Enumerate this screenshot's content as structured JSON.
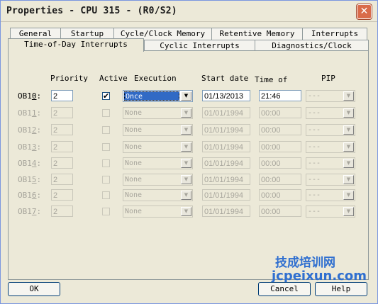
{
  "window": {
    "title": "Properties - CPU 315 - (R0/S2)",
    "close_glyph": "✕"
  },
  "tabs_row1": [
    "General",
    "Startup",
    "Cycle/Clock Memory",
    "Retentive Memory",
    "Interrupts"
  ],
  "tabs_row2": [
    "Time-of-Day Interrupts",
    "Cyclic Interrupts",
    "Diagnostics/Clock"
  ],
  "headers": {
    "priority": "Priority",
    "active": "Active",
    "execution": "Execution",
    "start_date": "Start date",
    "time_of": "Time of",
    "pip": "PIP"
  },
  "rows": [
    {
      "ob": "OB10",
      "ob_ul": "0",
      "priority": "2",
      "active": true,
      "execution": "Once",
      "start_date": "01/13/2013",
      "time": "21:46",
      "pip": "---",
      "enabled": true
    },
    {
      "ob": "OB11",
      "ob_ul": "1",
      "priority": "2",
      "active": false,
      "execution": "None",
      "start_date": "01/01/1994",
      "time": "00:00",
      "pip": "---",
      "enabled": false
    },
    {
      "ob": "OB12",
      "ob_ul": "2",
      "priority": "2",
      "active": false,
      "execution": "None",
      "start_date": "01/01/1994",
      "time": "00:00",
      "pip": "---",
      "enabled": false
    },
    {
      "ob": "OB13",
      "ob_ul": "3",
      "priority": "2",
      "active": false,
      "execution": "None",
      "start_date": "01/01/1994",
      "time": "00:00",
      "pip": "---",
      "enabled": false
    },
    {
      "ob": "OB14",
      "ob_ul": "4",
      "priority": "2",
      "active": false,
      "execution": "None",
      "start_date": "01/01/1994",
      "time": "00:00",
      "pip": "---",
      "enabled": false
    },
    {
      "ob": "OB15",
      "ob_ul": "5",
      "priority": "2",
      "active": false,
      "execution": "None",
      "start_date": "01/01/1994",
      "time": "00:00",
      "pip": "---",
      "enabled": false
    },
    {
      "ob": "OB16",
      "ob_ul": "6",
      "priority": "2",
      "active": false,
      "execution": "None",
      "start_date": "01/01/1994",
      "time": "00:00",
      "pip": "---",
      "enabled": false
    },
    {
      "ob": "OB17",
      "ob_ul": "7",
      "priority": "2",
      "active": false,
      "execution": "None",
      "start_date": "01/01/1994",
      "time": "00:00",
      "pip": "---",
      "enabled": false
    }
  ],
  "buttons": {
    "ok": "OK",
    "cancel": "Cancel",
    "help": "Help"
  },
  "watermark": {
    "line1": "技成培训网",
    "line2": "jcpeixun.com"
  },
  "colors": {
    "selection": "#316ac5",
    "close": "#d96b4a",
    "watermark": "#2f6fd0"
  },
  "icons": {
    "check": "✔",
    "dropdown": "▼"
  }
}
